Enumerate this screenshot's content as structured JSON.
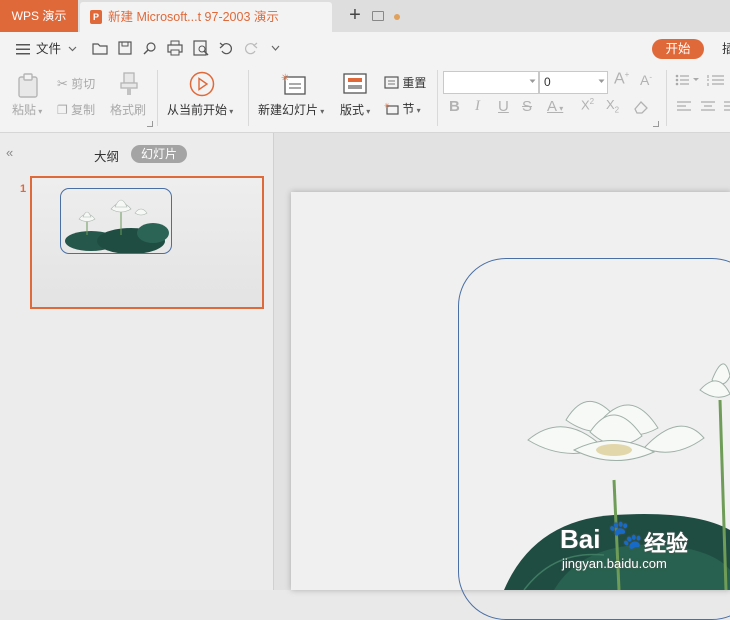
{
  "tabs": {
    "app_label": "WPS 演示",
    "doc_badge": "P",
    "doc_title": "新建 Microsoft...t 97-2003 演示",
    "new_tab": "+"
  },
  "menu": {
    "file": "文件",
    "start": "开始",
    "insert": "插"
  },
  "ribbon": {
    "paste": "粘贴",
    "cut": "剪切",
    "copy": "复制",
    "format_painter": "格式刷",
    "play_from_current": "从当前开始",
    "new_slide": "新建幻灯片",
    "layout": "版式",
    "reset": "重置",
    "section": "节",
    "font_size": "0"
  },
  "panel": {
    "outline_tab": "大纲",
    "slides_tab": "幻灯片",
    "slide_number": "1"
  },
  "watermark": {
    "brand": "Bai",
    "brand2": "经验",
    "url": "jingyan.baidu.com"
  },
  "colors": {
    "accent": "#e0693a",
    "frame": "#4a6fa5"
  },
  "icons": [
    "menu-icon",
    "open-folder-icon",
    "save-icon",
    "find-icon",
    "print-icon",
    "print-preview-icon",
    "undo-icon",
    "redo-icon",
    "customize-icon"
  ]
}
